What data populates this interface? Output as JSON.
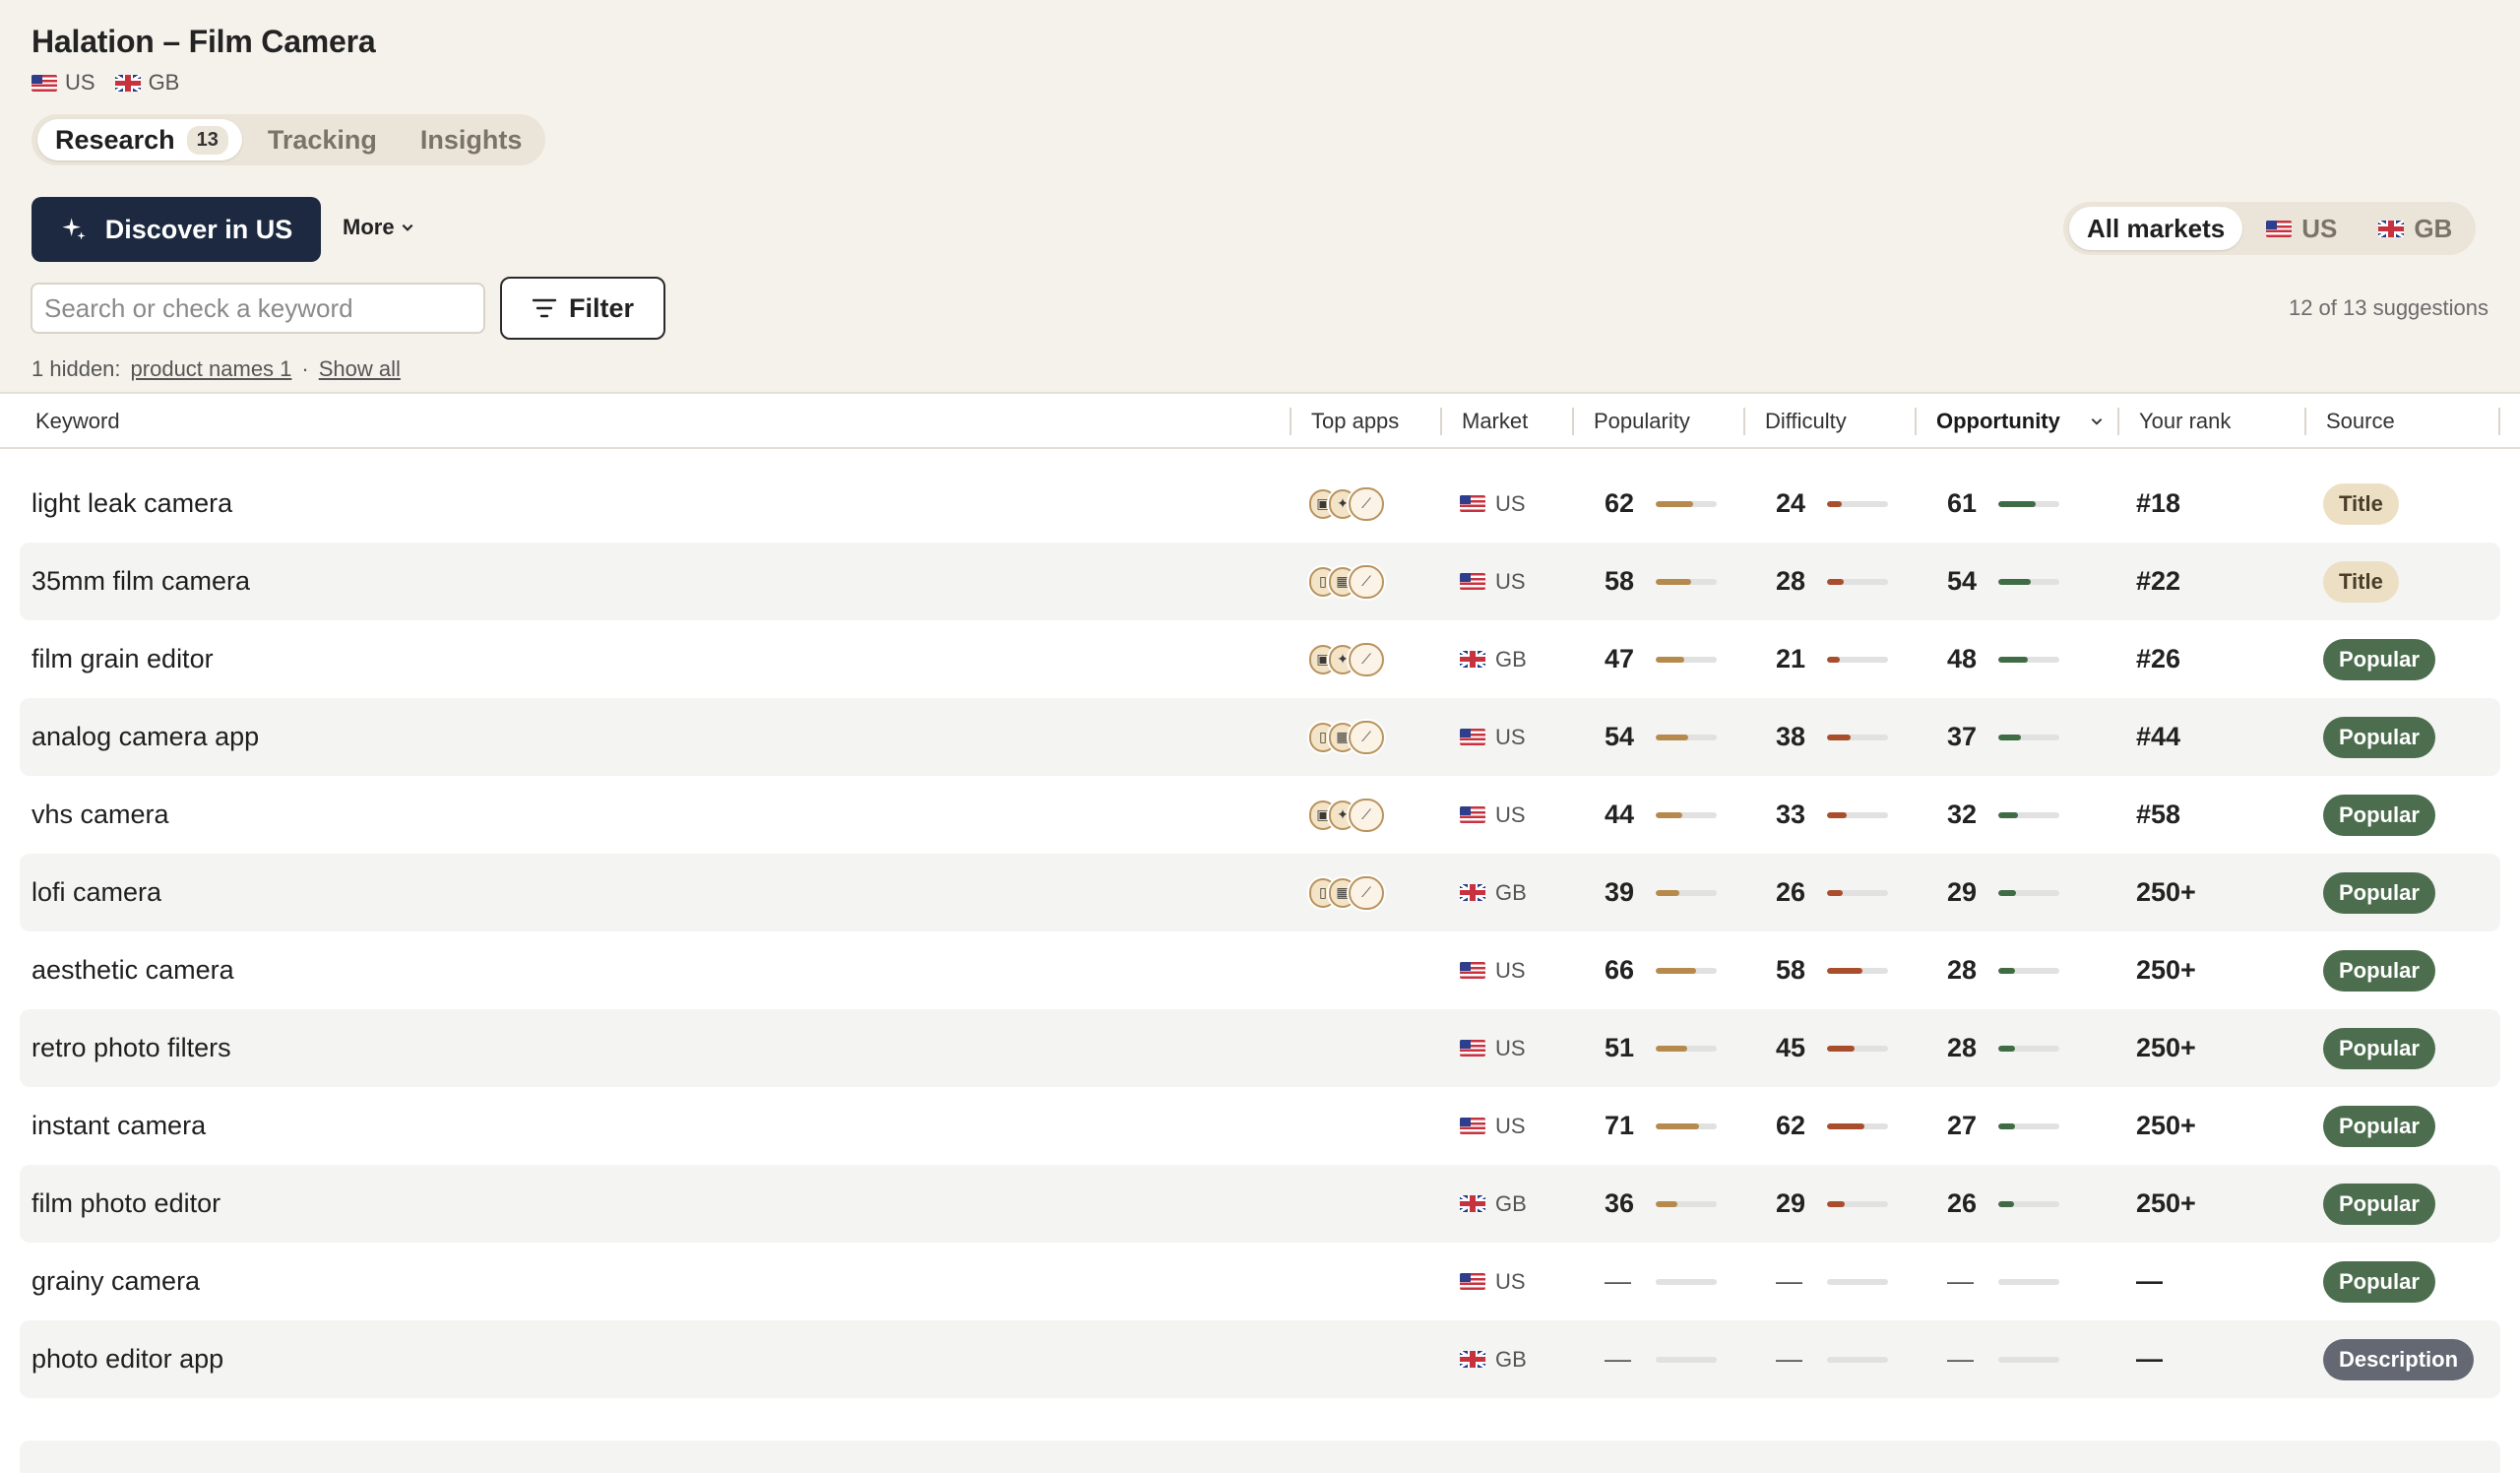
{
  "app": {
    "title": "Halation – Film Camera",
    "markets": [
      {
        "flag": "us-flag-icon",
        "code": "US"
      },
      {
        "flag": "gb-flag-icon",
        "code": "GB"
      }
    ]
  },
  "tabs": [
    {
      "label": "Research",
      "count": "13",
      "active": true
    },
    {
      "label": "Tracking",
      "active": false
    },
    {
      "label": "Insights",
      "active": false
    }
  ],
  "toolbar": {
    "discover_label": "Discover in US",
    "more_label": "More",
    "filter_label": "Filter",
    "search_placeholder": "Search or check a keyword",
    "suggestions_text": "12 of 13 suggestions"
  },
  "market_filter": {
    "options": [
      {
        "label": "All markets",
        "active": true
      },
      {
        "label": "US",
        "flag": "us-flag-icon"
      },
      {
        "label": "GB",
        "flag": "gb-flag-icon"
      }
    ]
  },
  "hidden": {
    "prefix": "1 hidden:",
    "link": "product names 1",
    "separator": "·",
    "show_all": "Show all"
  },
  "columns": [
    "Keyword",
    "Top apps",
    "Market",
    "Popularity",
    "Difficulty",
    "Opportunity",
    "Your rank",
    "Source"
  ],
  "sorted_column": "Opportunity",
  "colors": {
    "popularity": "#b58a4c",
    "difficulty": "#a94e2c",
    "opportunity": "#3f6b45",
    "title_badge": "#ecdfc4",
    "popular_badge": "#4c6e4e",
    "description_badge": "#646873",
    "primary_button": "#1c2940"
  },
  "rows": [
    {
      "keyword": "light leak camera",
      "apps": "A",
      "market": "US",
      "popularity": 62,
      "difficulty": 24,
      "opportunity": 61,
      "rank": "#18",
      "source": "Title"
    },
    {
      "keyword": "35mm film camera",
      "apps": "B",
      "market": "US",
      "popularity": 58,
      "difficulty": 28,
      "opportunity": 54,
      "rank": "#22",
      "source": "Title"
    },
    {
      "keyword": "film grain editor",
      "apps": "A",
      "market": "GB",
      "popularity": 47,
      "difficulty": 21,
      "opportunity": 48,
      "rank": "#26",
      "source": "Popular"
    },
    {
      "keyword": "analog camera app",
      "apps": "B",
      "market": "US",
      "popularity": 54,
      "difficulty": 38,
      "opportunity": 37,
      "rank": "#44",
      "source": "Popular"
    },
    {
      "keyword": "vhs camera",
      "apps": "A",
      "market": "US",
      "popularity": 44,
      "difficulty": 33,
      "opportunity": 32,
      "rank": "#58",
      "source": "Popular"
    },
    {
      "keyword": "lofi camera",
      "apps": "B",
      "market": "GB",
      "popularity": 39,
      "difficulty": 26,
      "opportunity": 29,
      "rank": "250+",
      "source": "Popular"
    },
    {
      "keyword": "aesthetic camera",
      "apps": "",
      "market": "US",
      "popularity": 66,
      "difficulty": 58,
      "opportunity": 28,
      "rank": "250+",
      "source": "Popular"
    },
    {
      "keyword": "retro photo filters",
      "apps": "",
      "market": "US",
      "popularity": 51,
      "difficulty": 45,
      "opportunity": 28,
      "rank": "250+",
      "source": "Popular"
    },
    {
      "keyword": "instant camera",
      "apps": "",
      "market": "US",
      "popularity": 71,
      "difficulty": 62,
      "opportunity": 27,
      "rank": "250+",
      "source": "Popular"
    },
    {
      "keyword": "film photo editor",
      "apps": "",
      "market": "GB",
      "popularity": 36,
      "difficulty": 29,
      "opportunity": 26,
      "rank": "250+",
      "source": "Popular"
    },
    {
      "keyword": "grainy camera",
      "apps": "",
      "market": "US",
      "popularity": null,
      "difficulty": null,
      "opportunity": null,
      "rank": "—",
      "source": "Popular"
    },
    {
      "keyword": "photo editor app",
      "apps": "",
      "market": "GB",
      "popularity": null,
      "difficulty": null,
      "opportunity": null,
      "rank": "—",
      "source": "Description"
    }
  ]
}
